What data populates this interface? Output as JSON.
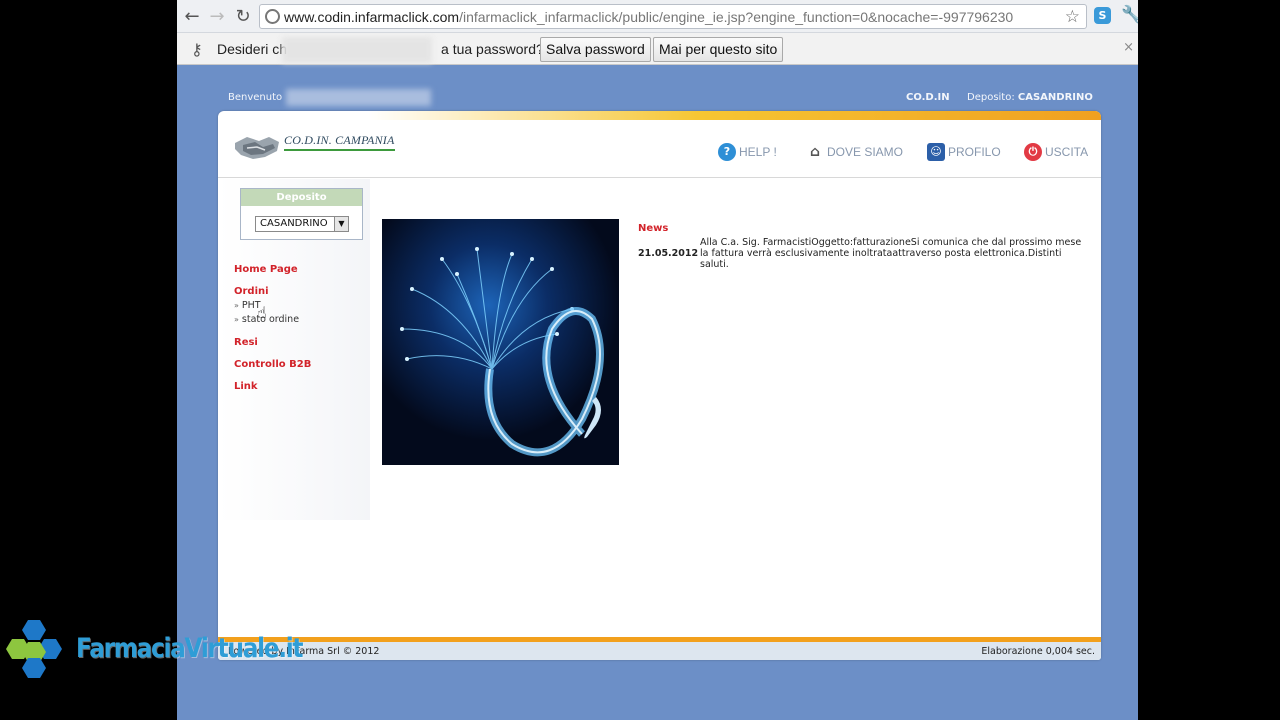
{
  "browser": {
    "url_host": "www.codin.infarmaclick.com",
    "url_path": "/infarmaclick_infarmaclick/public/engine_ie.jsp?engine_function=0&nocache=-997796230",
    "infobar": {
      "message_start": "Desideri ch",
      "message_end": "a tua password?",
      "save_button": "Salva password",
      "never_button": "Mai per questo sito",
      "close_glyph": "×"
    }
  },
  "page": {
    "welcome_label": "Benvenuto",
    "company": "CO.D.IN",
    "deposito_label": "Deposito:",
    "deposito_value": "CASANDRINO",
    "logo_text": "CO.D.IN. CAMPANIA",
    "nav": {
      "help": "HELP !",
      "dove_siamo": "DOVE SIAMO",
      "profilo": "PROFILO",
      "uscita": "USCITA"
    },
    "sidebar": {
      "deposito_header": "Deposito",
      "deposito_select": "CASANDRINO",
      "home": "Home Page",
      "ordini": "Ordini",
      "ordini_sub_1": "PHT",
      "ordini_sub_2": "stato ordine",
      "resi": "Resi",
      "controllo": "Controllo B2B",
      "link": "Link"
    },
    "news": {
      "title": "News",
      "date": "21.05.2012",
      "text": "Alla C.a. Sig. FarmacistiOggetto:fatturazioneSi comunica che dal prossimo mese la fattura verrà esclusivamente inoltrataattraverso posta elettronica.Distinti saluti."
    },
    "footer": {
      "left": "Powered by InFarma Srl © 2012",
      "right": "Elaborazione 0,004 sec."
    }
  },
  "watermark": {
    "text": "FarmaciaVirtuale.it"
  },
  "colors": {
    "page_bg": "#6c8fc7",
    "menu_red": "#d2232a",
    "accent_orange": "#f2a01c",
    "watermark_blue": "#2f9dd6"
  }
}
